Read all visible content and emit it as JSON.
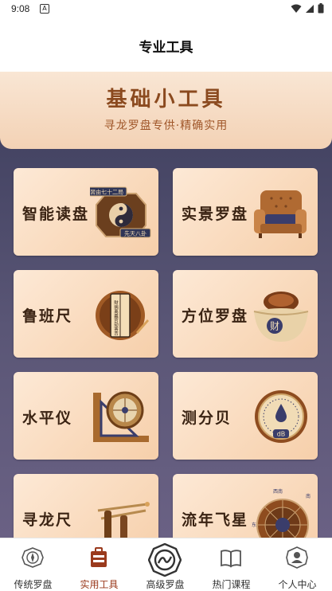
{
  "status_bar": {
    "time": "9:08",
    "notification_glyph": "A"
  },
  "header": {
    "title": "专业工具"
  },
  "banner": {
    "title": "基础小工具",
    "subtitle": "寻龙罗盘专供·精确实用"
  },
  "tools": [
    {
      "label": "智能读盘",
      "icon": "bagua-book-icon",
      "art_text_1": "習由七十二局",
      "art_text_2": "先天八卦"
    },
    {
      "label": "实景罗盘",
      "icon": "sofa-icon"
    },
    {
      "label": "鲁班尺",
      "icon": "luban-ruler-icon",
      "art_text_1": "財病离義官劫害吉"
    },
    {
      "label": "方位罗盘",
      "icon": "gold-ingot-icon",
      "art_text_1": "财"
    },
    {
      "label": "水平仪",
      "icon": "level-gauge-icon"
    },
    {
      "label": "测分贝",
      "icon": "decibel-meter-icon",
      "art_text_1": "dB"
    },
    {
      "label": "寻龙尺",
      "icon": "dowsing-rod-icon"
    },
    {
      "label": "流年飞星",
      "icon": "flying-star-wheel-icon",
      "art_text_1": "西南",
      "art_text_2": "东",
      "art_text_3": "南"
    }
  ],
  "tabbar": {
    "active_color": "#9a3a1d",
    "items": [
      {
        "label": "传统罗盘",
        "icon": "compass-icon"
      },
      {
        "label": "实用工具",
        "icon": "toolbox-icon",
        "active": true
      },
      {
        "label": "高级罗盘",
        "icon": "taiji-icon"
      },
      {
        "label": "热门课程",
        "icon": "book-icon"
      },
      {
        "label": "个人中心",
        "icon": "user-icon"
      }
    ]
  }
}
